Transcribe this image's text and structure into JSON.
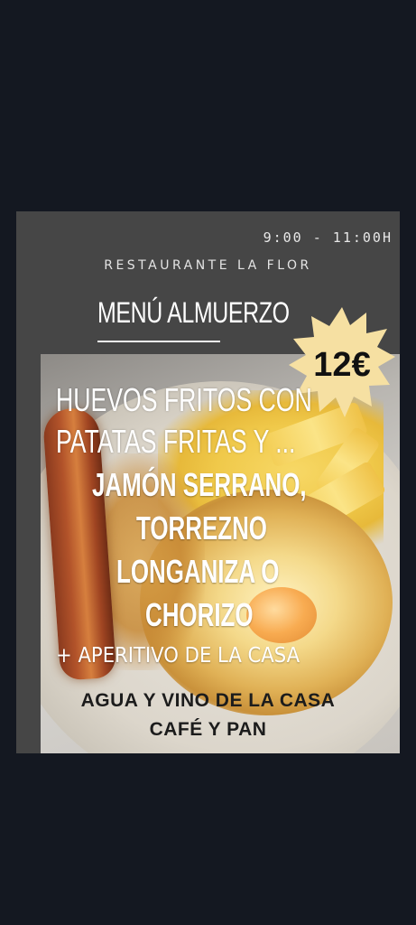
{
  "poster": {
    "hours": "9:00 - 11:00H",
    "restaurant": "RESTAURANTE LA FLOR",
    "menu_title": "MENÚ ALMUERZO",
    "price": "12€",
    "dish_lines": [
      "HUEVOS FRITOS CON",
      "PATATAS FRITAS Y ..."
    ],
    "extras": [
      "JAMÓN SERRANO,",
      "TORREZNO",
      "LONGANIZA O",
      "CHORIZO"
    ],
    "aperitivo": "+ APERITIVO DE LA CASA",
    "included": [
      "AGUA Y VINO DE LA CASA",
      "CAFÉ Y PAN"
    ]
  },
  "colors": {
    "background": "#141821",
    "poster_bg": "#464646",
    "badge": "#f6e0a2",
    "text_light": "#ffffff",
    "text_dark": "#1c1c1c"
  }
}
